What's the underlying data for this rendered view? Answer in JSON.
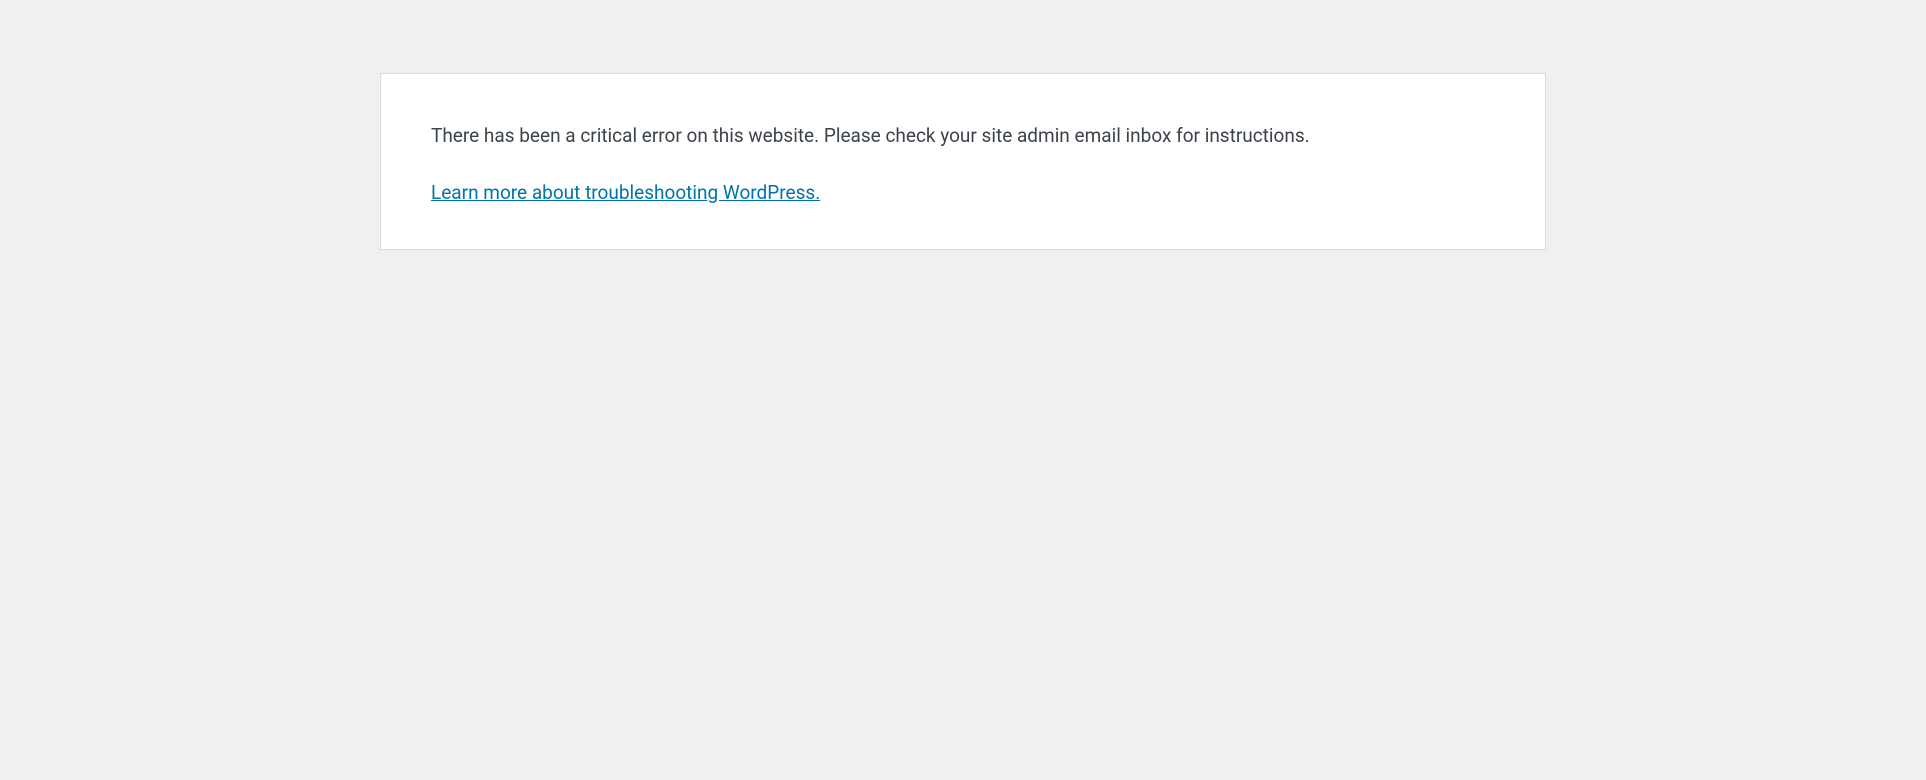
{
  "error": {
    "message": "There has been a critical error on this website. Please check your site admin email inbox for instructions.",
    "link_text": "Learn more about troubleshooting WordPress."
  }
}
